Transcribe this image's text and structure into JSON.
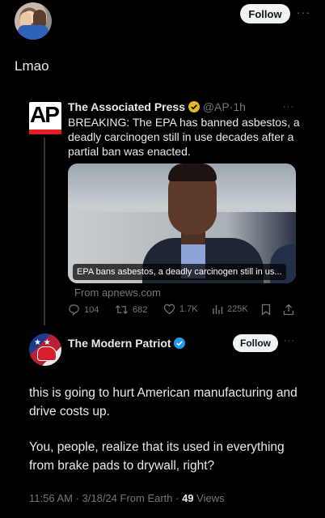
{
  "top": {
    "follow_label": "Follow",
    "more_label": "···"
  },
  "post": {
    "text": "Lmao"
  },
  "quoted": {
    "author": "The Associated Press",
    "handle": "@AP",
    "dot": "·",
    "time": "1h",
    "more_label": "···",
    "body": "BREAKING: The EPA has banned asbestos, a deadly carcinogen still in use decades after a partial ban was enacted.",
    "logo_text": "AP",
    "image_caption": "EPA bans asbestos, a deadly carcinogen still in us...",
    "from_text": "From apnews.com",
    "metrics": {
      "replies": "104",
      "reposts": "682",
      "likes": "1.7K",
      "views": "225K"
    }
  },
  "reply": {
    "author": "The Modern Patriot",
    "follow_label": "Follow",
    "more_label": "···",
    "paragraph1": "this is going to hurt American manufacturing and drive costs up.",
    "paragraph2": "You, people, realize that its used in everything from brake pads to drywall, right?",
    "footer_time": "11:56 AM · 3/18/24 From Earth ·",
    "footer_views_count": "49",
    "footer_views_label": "Views"
  },
  "colors": {
    "background": "#000000",
    "text": "#e7e9ea",
    "muted": "#71767b",
    "verified_gold": "#e2b719",
    "verified_blue": "#1d9bf0",
    "ap_red": "#e31b23"
  },
  "icons": [
    "reply-icon",
    "repost-icon",
    "like-icon",
    "views-icon",
    "bookmark-icon",
    "share-icon",
    "verified-gold-icon",
    "verified-blue-icon"
  ]
}
